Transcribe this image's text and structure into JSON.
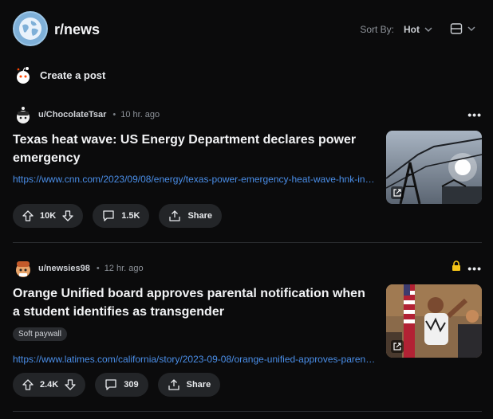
{
  "header": {
    "subreddit": "r/news",
    "sort_label": "Sort By:",
    "sort_value": "Hot"
  },
  "create_post": {
    "label": "Create a post"
  },
  "posts": [
    {
      "user": "u/ChocolateTsar",
      "time": "10 hr. ago",
      "title": "Texas heat wave: US Energy Department declares power emergency",
      "link": "https://www.cnn.com/2023/09/08/energy/texas-power-emergency-heat-wave-hnk-intl/index.html",
      "upvotes": "10K",
      "comments": "1.5K",
      "share": "Share"
    },
    {
      "user": "u/newsies98",
      "time": "12 hr. ago",
      "title": "Orange Unified board approves parental notification when a student identifies as transgender",
      "flair": "Soft paywall",
      "link": "https://www.latimes.com/california/story/2023-09-08/orange-unified-approves-parental-notification",
      "upvotes": "2.4K",
      "comments": "309",
      "share": "Share"
    }
  ],
  "colors": {
    "background": "#0b0b0c",
    "link": "#4a8ee8",
    "pill": "#232528",
    "lock": "#f5c518"
  }
}
